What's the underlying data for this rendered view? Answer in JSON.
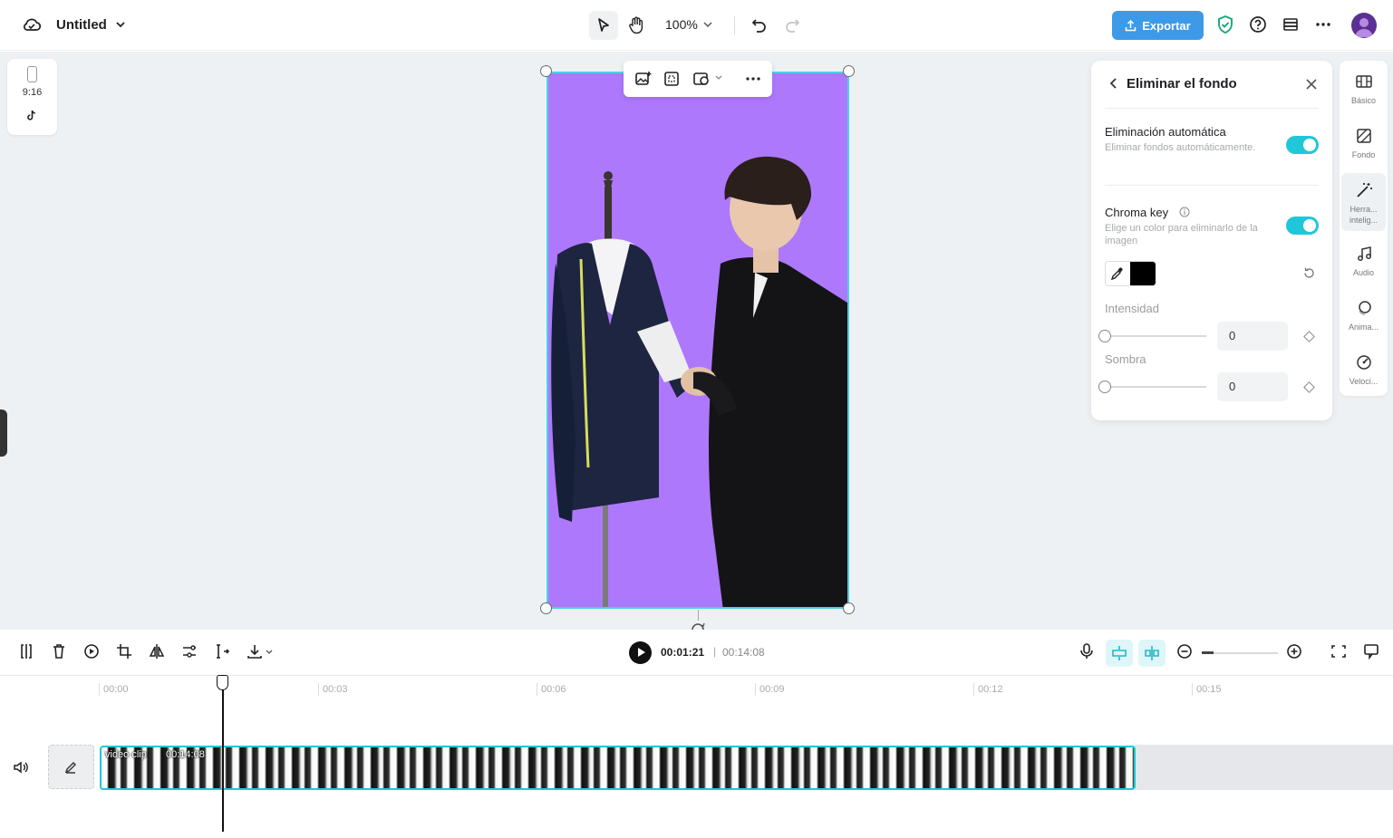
{
  "header": {
    "project_title": "Untitled",
    "zoom_level": "100%",
    "export_label": "Exportar"
  },
  "canvas": {
    "aspect_ratio": "9:16",
    "background_color": "#ae78fc"
  },
  "panel": {
    "title": "Eliminar el fondo",
    "auto_removal": {
      "title": "Eliminación automática",
      "description": "Eliminar fondos automáticamente.",
      "enabled": true
    },
    "chroma_key": {
      "title": "Chroma key",
      "description": "Elige un color para eliminarlo de la imagen",
      "enabled": true,
      "color": "#000000"
    },
    "intensity": {
      "label": "Intensidad",
      "value": "0"
    },
    "shadow": {
      "label": "Sombra",
      "value": "0"
    }
  },
  "side_tabs": [
    {
      "label": "Básico",
      "icon": "film-icon"
    },
    {
      "label": "Fondo",
      "icon": "background-icon"
    },
    {
      "label": "Herra... intelig...",
      "icon": "magic-wand-icon"
    },
    {
      "label": "Audio",
      "icon": "music-note-icon"
    },
    {
      "label": "Anima...",
      "icon": "animation-icon"
    },
    {
      "label": "Veloci...",
      "icon": "speed-icon"
    }
  ],
  "timeline": {
    "current_time": "00:01:21",
    "separator": "|",
    "total_time": "00:14:08",
    "ruler_ticks": [
      "00:00",
      "00:03",
      "00:06",
      "00:09",
      "00:12",
      "00:15"
    ],
    "clip": {
      "label": "video clip",
      "duration": "00:14:08"
    }
  },
  "colors": {
    "accent": "#1fc7d9",
    "export_button": "#3d9ae8",
    "selection": "#4ad2e4"
  }
}
